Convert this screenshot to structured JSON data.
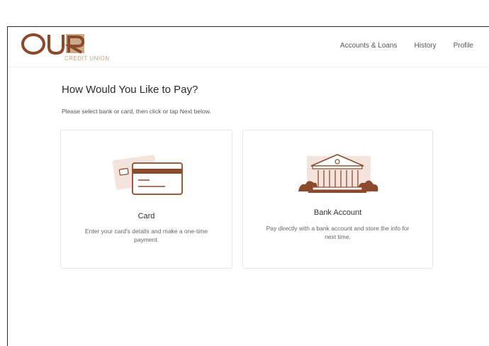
{
  "brand": {
    "logo_text": "OUR",
    "logo_subtitle": "CREDIT UNION",
    "colors": {
      "brown": "#8b4a2b",
      "tan": "#b98f6a",
      "light": "#f3e4de"
    }
  },
  "nav": {
    "items": [
      "Accounts & Loans",
      "History",
      "Profile"
    ]
  },
  "main": {
    "title": "How Would You Like to Pay?",
    "instructions": "Please select bank or card, then click or tap Next below.",
    "options": [
      {
        "icon": "credit-card-icon",
        "title": "Card",
        "description": "Enter your card's details and make a one-time payment."
      },
      {
        "icon": "bank-building-icon",
        "title": "Bank Account",
        "description": "Pay directly with a bank account and store the info for next time."
      }
    ]
  }
}
